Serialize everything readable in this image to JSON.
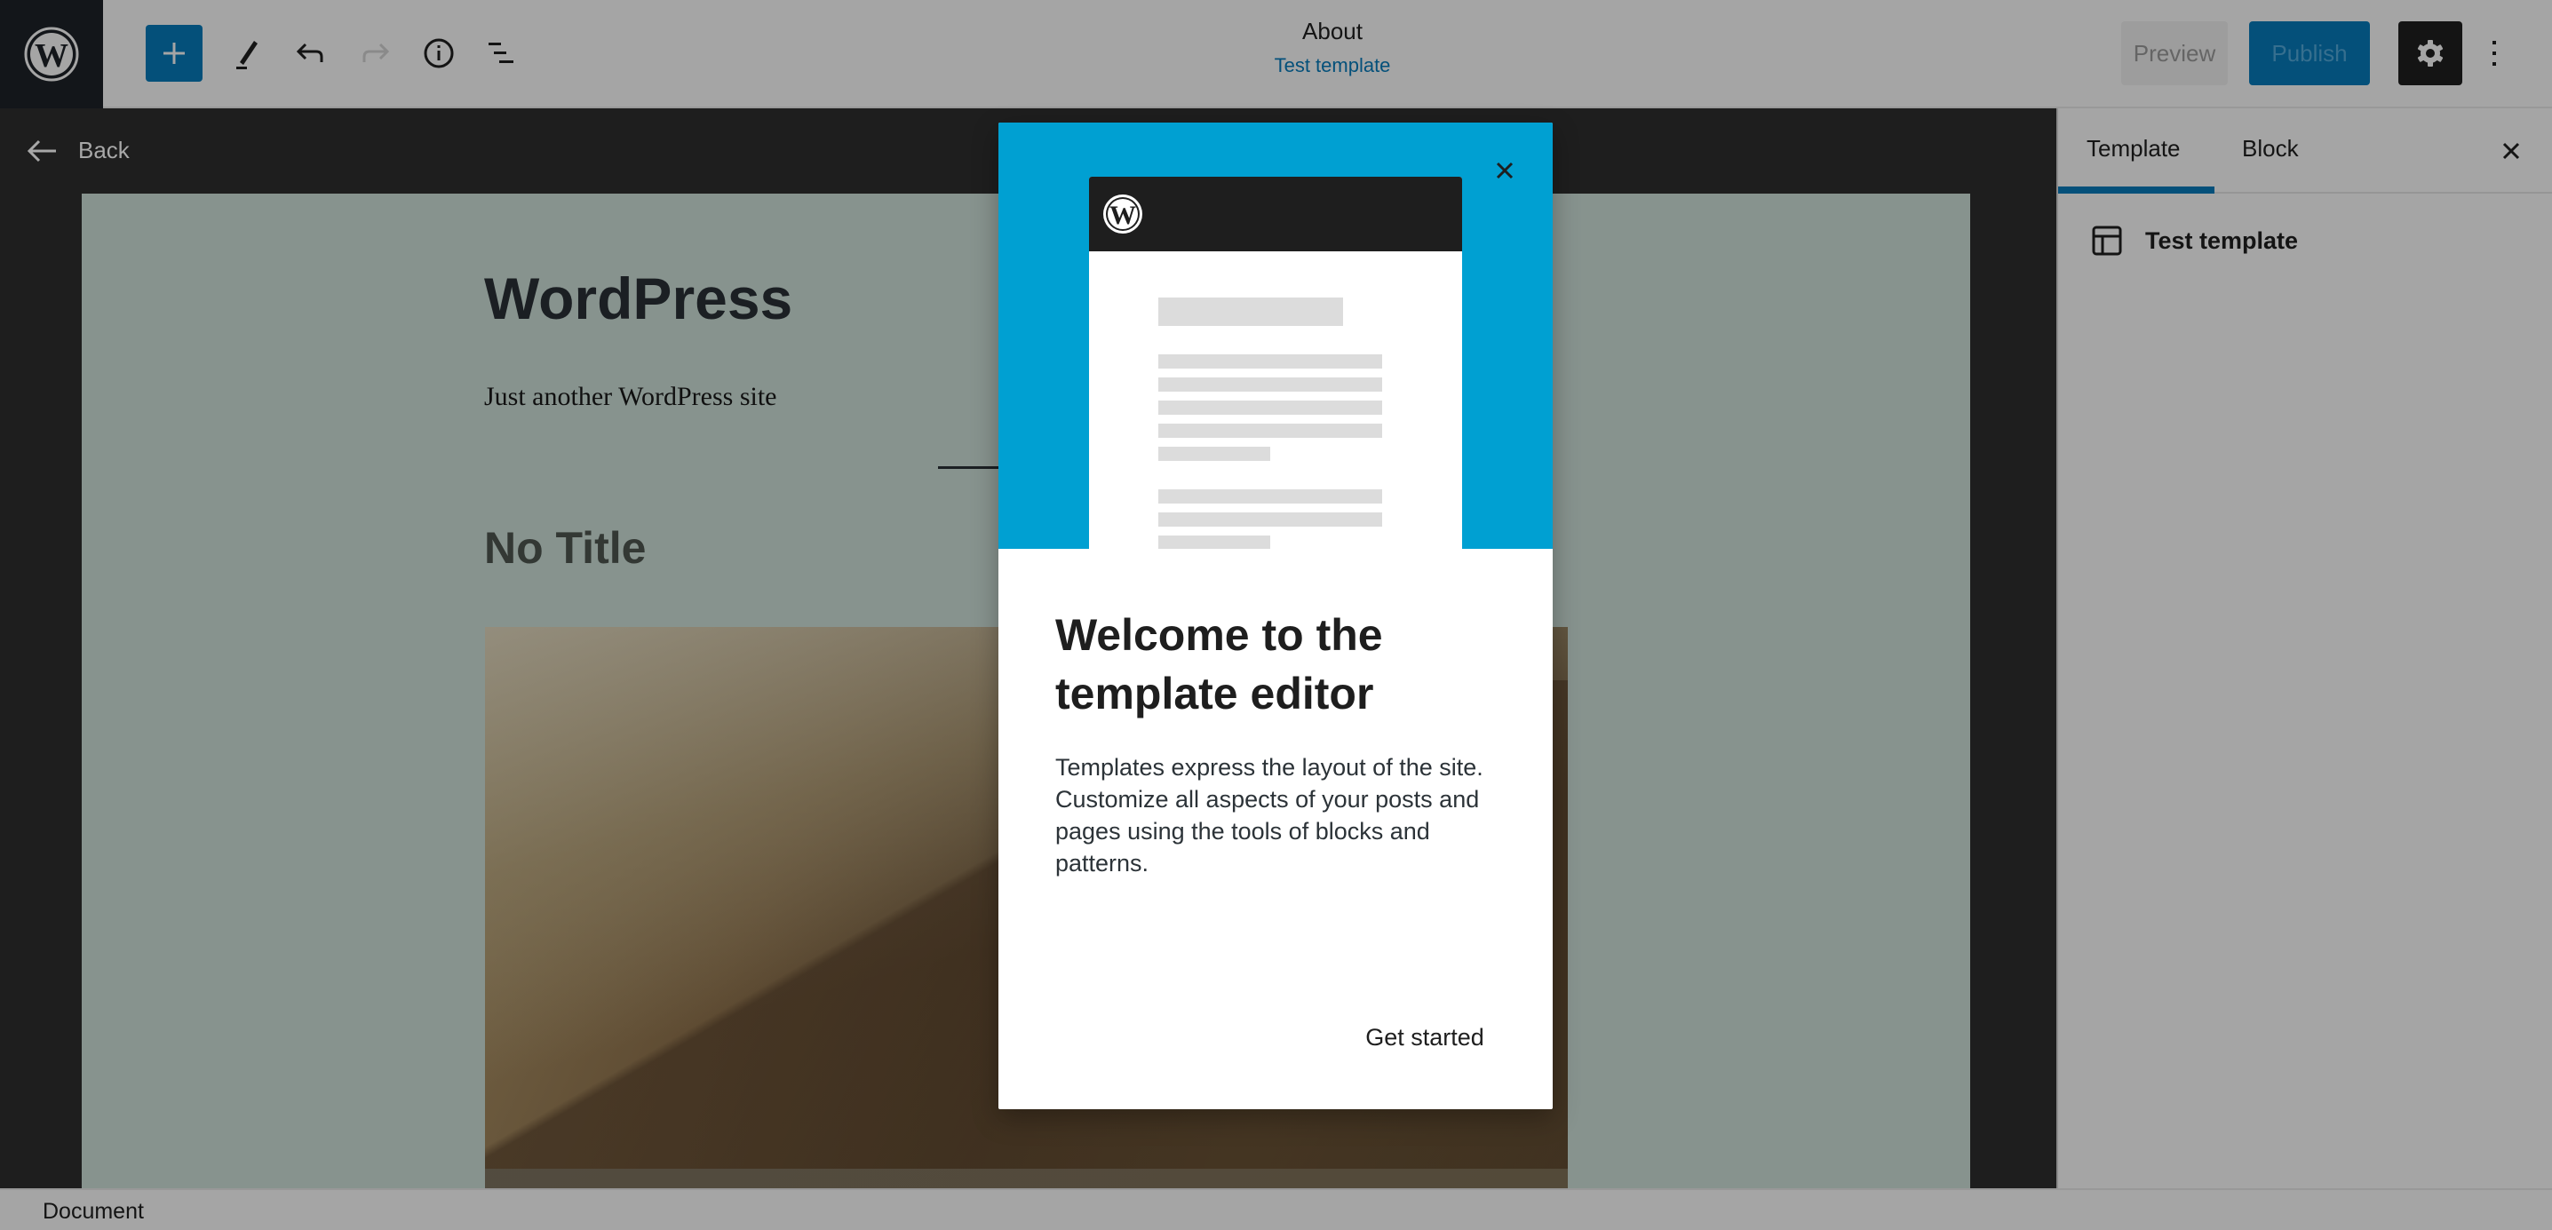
{
  "header": {
    "logo_icon": "wordpress-logo-icon",
    "toolbar": {
      "inserter_icon": "plus-icon",
      "tools_icon": "pencil-icon",
      "undo_icon": "undo-icon",
      "redo_icon": "redo-icon",
      "details_icon": "info-icon",
      "list_view_icon": "list-view-icon"
    },
    "document_title": "About",
    "template_link": "Test template",
    "preview_label": "Preview",
    "publish_label": "Publish",
    "settings_icon": "gear-icon",
    "more_icon": "more-vertical-icon"
  },
  "editor": {
    "back_label": "Back",
    "back_icon": "arrow-left-icon",
    "site_title": "WordPress",
    "site_tagline": "Just another WordPress site",
    "post_title": "No Title",
    "featured_image": "mountain-hiker-image"
  },
  "sidebar": {
    "tabs": [
      {
        "label": "Template",
        "active": true
      },
      {
        "label": "Block",
        "active": false
      }
    ],
    "close_icon": "close-icon",
    "template_icon": "layout-icon",
    "template_name": "Test template"
  },
  "statusbar": {
    "breadcrumb": "Document"
  },
  "modal": {
    "close_icon": "close-icon",
    "illustration": "template-editor-illustration",
    "heading": "Welcome to the template editor",
    "body": "Templates express the layout of the site. Customize all aspects of your posts and pages using the tools of blocks and patterns.",
    "primary_button": "Get started"
  },
  "colors": {
    "accent": "#04507a",
    "illustration_bg": "#00a0d2",
    "canvas_bg": "#87938e",
    "overlay_header": "#a5a5a5"
  }
}
